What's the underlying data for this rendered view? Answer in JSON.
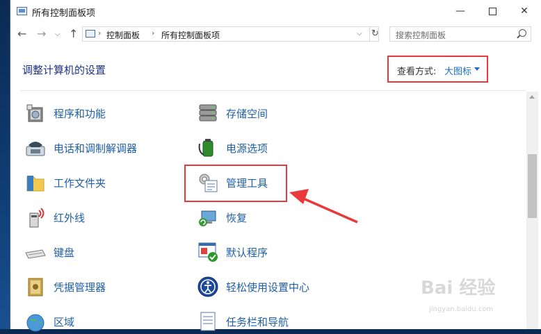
{
  "window": {
    "title": "所有控制面板项"
  },
  "address": {
    "crumbs": [
      "控制面板",
      "所有控制面板项"
    ],
    "search_placeholder": "搜索控制面板"
  },
  "header": {
    "title": "调整计算机的设置",
    "view_by_label": "查看方式:",
    "view_by_value": "大图标"
  },
  "items": {
    "left": [
      {
        "label": "程序和功能",
        "icon": "programs-icon"
      },
      {
        "label": "电话和调制解调器",
        "icon": "phone-modem-icon"
      },
      {
        "label": "工作文件夹",
        "icon": "work-folders-icon"
      },
      {
        "label": "红外线",
        "icon": "infrared-icon"
      },
      {
        "label": "键盘",
        "icon": "keyboard-icon"
      },
      {
        "label": "凭据管理器",
        "icon": "credential-icon"
      },
      {
        "label": "区域",
        "icon": "region-icon"
      }
    ],
    "right": [
      {
        "label": "存储空间",
        "icon": "storage-icon"
      },
      {
        "label": "电源选项",
        "icon": "power-icon"
      },
      {
        "label": "管理工具",
        "icon": "admin-tools-icon"
      },
      {
        "label": "恢复",
        "icon": "recovery-icon"
      },
      {
        "label": "默认程序",
        "icon": "default-programs-icon"
      },
      {
        "label": "轻松使用设置中心",
        "icon": "ease-of-access-icon"
      },
      {
        "label": "任务栏和导航",
        "icon": "taskbar-icon"
      }
    ]
  },
  "watermark": {
    "text": "Bai 经验",
    "sub": "jingyan.baidu.com"
  },
  "colors": {
    "link": "#1f5fa8",
    "title": "#1e3287",
    "highlight": "#e83a3a"
  }
}
